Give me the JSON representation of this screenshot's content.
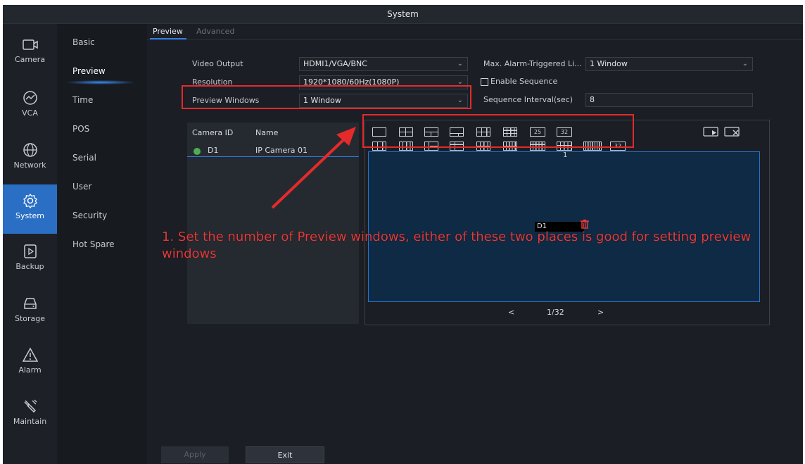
{
  "window": {
    "title": "System"
  },
  "nav": {
    "items": [
      {
        "label": "Camera",
        "icon": "camera-icon"
      },
      {
        "label": "VCA",
        "icon": "vca-icon"
      },
      {
        "label": "Network",
        "icon": "network-icon"
      },
      {
        "label": "System",
        "icon": "gear-icon",
        "active": true
      },
      {
        "label": "Backup",
        "icon": "backup-icon"
      },
      {
        "label": "Storage",
        "icon": "storage-icon"
      },
      {
        "label": "Alarm",
        "icon": "alarm-icon"
      },
      {
        "label": "Maintain",
        "icon": "wrench-icon"
      }
    ],
    "active_color": "#2a6fc4"
  },
  "subnav": {
    "items": [
      "Basic",
      "Preview",
      "Time",
      "POS",
      "Serial",
      "User",
      "Security",
      "Hot Spare"
    ],
    "active": "Preview"
  },
  "tabs": {
    "preview": "Preview",
    "advanced": "Advanced"
  },
  "settings": {
    "video_output": {
      "label": "Video Output",
      "value": "HDMI1/VGA/BNC"
    },
    "resolution": {
      "label": "Resolution",
      "value": "1920*1080/60Hz(1080P)"
    },
    "preview_windows": {
      "label": "Preview Windows",
      "value": "1 Window"
    },
    "max_alarm": {
      "label": "Max. Alarm-Triggered Li...",
      "value": "1 Window"
    },
    "enable_sequence": {
      "label": "Enable Sequence",
      "checked": false
    },
    "sequence_interval": {
      "label": "Sequence Interval(sec)",
      "value": "8"
    }
  },
  "camera_list": {
    "headers": [
      "Camera ID",
      "Name"
    ],
    "rows": [
      {
        "id": "D1",
        "name": "IP Camera 01",
        "status_color": "#4caf50"
      }
    ]
  },
  "preview": {
    "layout_text_icons": [
      "25",
      "32",
      "32"
    ],
    "window_number": "1",
    "window_label": "D1",
    "page": "1/32",
    "prev": "<",
    "next": ">"
  },
  "buttons": {
    "apply": "Apply",
    "exit": "Exit"
  },
  "annotation": {
    "text": "1. Set the number of Preview windows, either of these two places is good for setting preview windows",
    "color": "#e23b3b"
  }
}
